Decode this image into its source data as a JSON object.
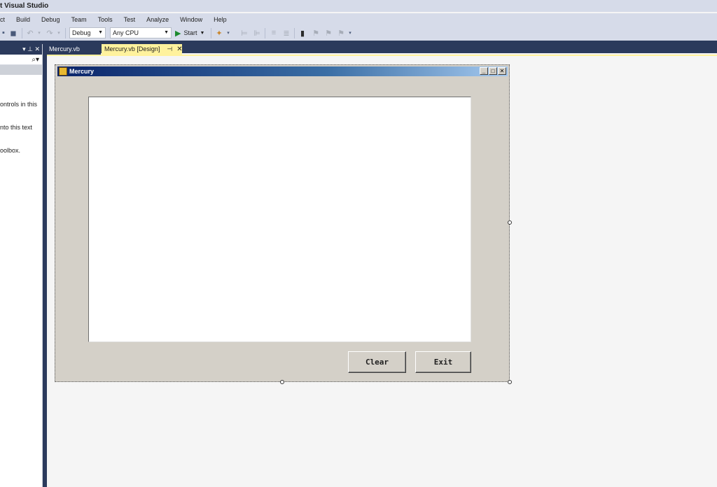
{
  "app": {
    "title": "t Visual Studio"
  },
  "menu": [
    "ct",
    "Build",
    "Debug",
    "Team",
    "Tools",
    "Test",
    "Analyze",
    "Window",
    "Help"
  ],
  "toolbar": {
    "config": "Debug",
    "platform": "Any CPU",
    "start_label": "Start"
  },
  "left_panel": {
    "header_controls": "▾ ⊥ ✕",
    "search_icon": "⌕▾",
    "description_lines": [
      "ontrols in this",
      "nto this text",
      "oolbox."
    ]
  },
  "tabs": [
    {
      "label": "Mercury.vb",
      "active": false
    },
    {
      "label": "Mercury.vb [Design]",
      "active": true
    }
  ],
  "form": {
    "title": "Mercury",
    "buttons": {
      "clear": "Clear",
      "exit": "Exit"
    },
    "title_controls": {
      "minimize": "_",
      "maximize": "□",
      "close": "✕"
    }
  },
  "colors": {
    "accent_dark": "#2b3a5c",
    "active_tab": "#fff29d",
    "form_bg": "#d4d0c8",
    "title_gradient_start": "#0a246a",
    "title_gradient_end": "#a6caf0"
  }
}
